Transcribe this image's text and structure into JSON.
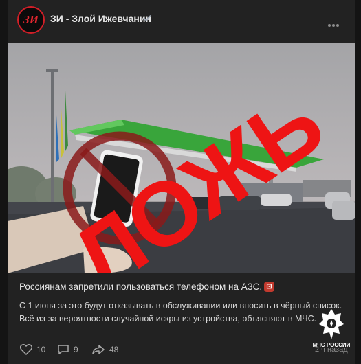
{
  "post": {
    "avatar_text": "ЗИ",
    "author": "ЗИ - Злой Ижевчанин",
    "image_stamp": "ЛОЖЬ",
    "title": "Россиянам запретили пользоваться телефоном на АЗС.",
    "body": "С 1 июня за это будут отказывать в обслуживании или вносить в чёрный список. Всё из-за вероятности случайной искры из устройства, объясняют в МЧС.",
    "likes": "10",
    "comments": "9",
    "shares": "48",
    "time": "2 ч назад"
  },
  "watermark": {
    "label": "МЧС РОССИИ"
  },
  "colors": {
    "stamp": "#ee1414",
    "background": "#222222",
    "brand": "#d21f28"
  }
}
